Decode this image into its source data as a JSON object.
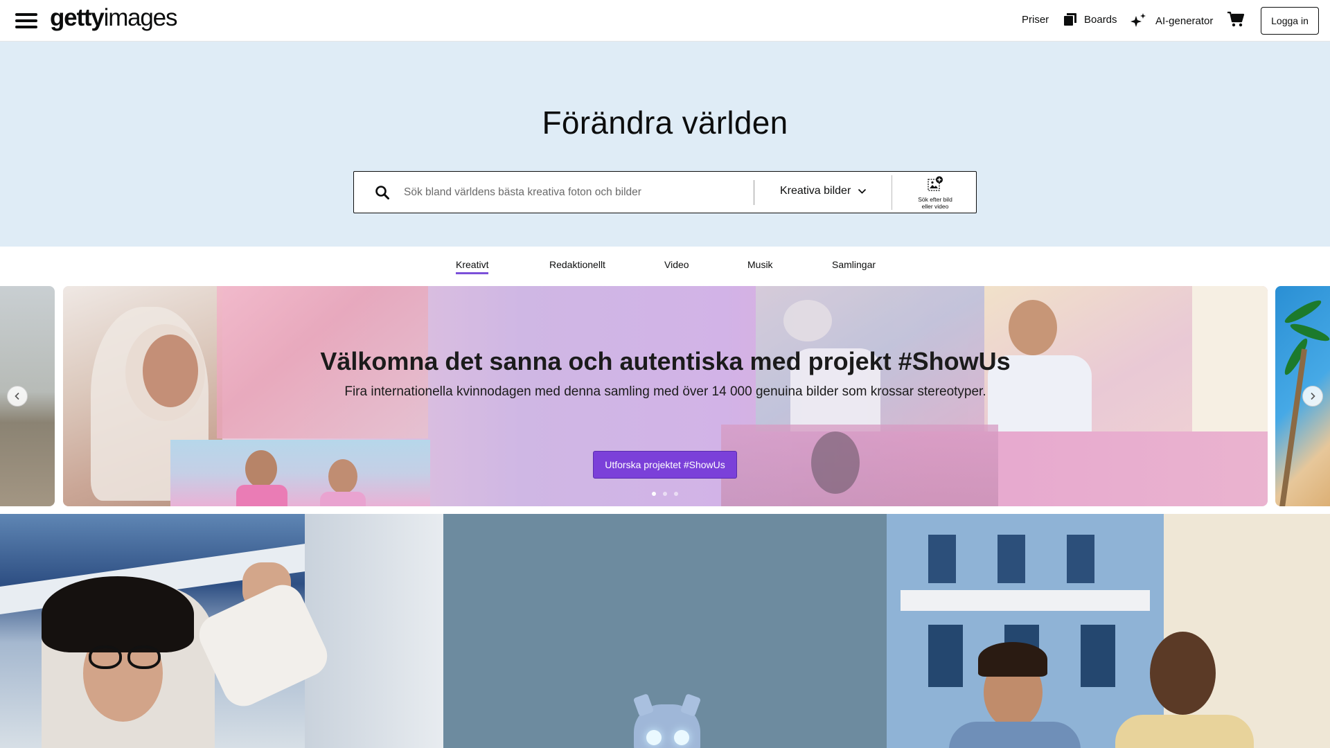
{
  "header": {
    "logo_bold": "getty",
    "logo_light": "images",
    "nav": {
      "pricing": "Priser",
      "boards": "Boards",
      "ai_generator": "AI-generator",
      "login": "Logga in"
    },
    "icons": [
      "hamburger-menu-icon",
      "boards-icon",
      "sparkle-icon",
      "cart-icon"
    ]
  },
  "hero": {
    "title": "Förändra världen",
    "search": {
      "placeholder": "Sök bland världens bästa kreativa foton och bilder",
      "value": "",
      "type_selected": "Kreativa bilder",
      "visual_search_label_line1": "Sök efter bild",
      "visual_search_label_line2": "eller video"
    }
  },
  "tabs": [
    {
      "label": "Kreativt",
      "active": true
    },
    {
      "label": "Redaktionellt",
      "active": false
    },
    {
      "label": "Video",
      "active": false
    },
    {
      "label": "Musik",
      "active": false
    },
    {
      "label": "Samlingar",
      "active": false
    }
  ],
  "carousel": {
    "title": "Välkomna det sanna och autentiska med projekt #ShowUs",
    "subtitle": "Fira internationella kvinnodagen med denna samling med över 14 000 genuina bilder som krossar stereotyper.",
    "cta": "Utforska projektet #ShowUs",
    "slide_count": 3,
    "active_slide": 1
  },
  "colors": {
    "accent": "#7b40d9",
    "hero_bg": "#dfecf6",
    "text": "#0c0d0d"
  }
}
